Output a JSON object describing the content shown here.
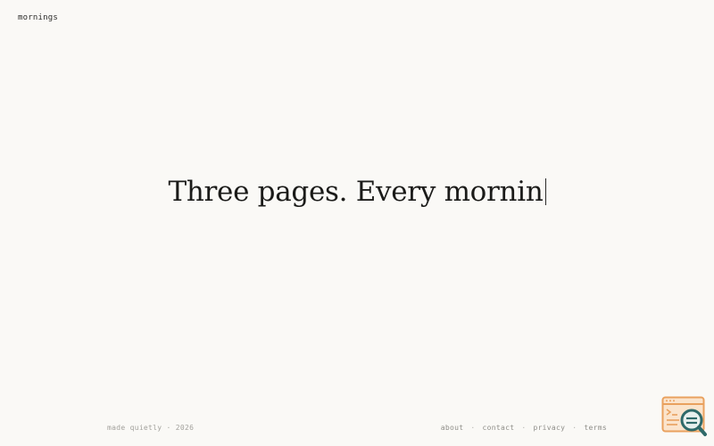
{
  "brand": {
    "name": "mornings"
  },
  "hero": {
    "text": "Three pages. Every mornin"
  },
  "footer": {
    "made": "made quietly",
    "dot": "·",
    "year": "2026",
    "links": [
      {
        "label": "about"
      },
      {
        "label": "contact"
      },
      {
        "label": "privacy"
      },
      {
        "label": "terms"
      }
    ],
    "separator": "·"
  },
  "colors": {
    "background": "#faf9f6",
    "text": "#1b1b19",
    "muted": "#a3a29d",
    "widget_orange": "#e9a15e",
    "widget_teal": "#2f6a6a"
  },
  "icons": {
    "inspector": "code-search-icon"
  }
}
